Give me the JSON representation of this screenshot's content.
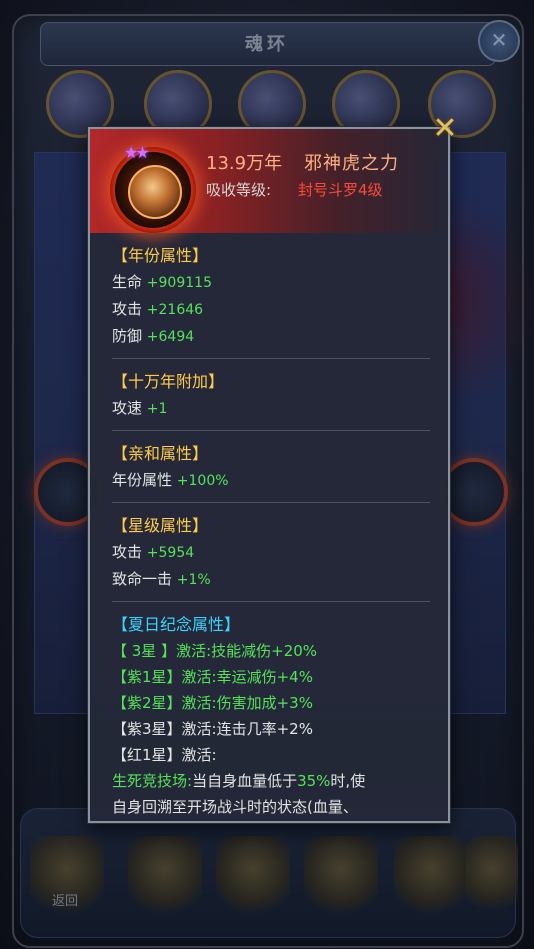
{
  "background": {
    "title": "魂环",
    "bottom_nav": [
      "返回",
      "",
      "",
      "",
      "",
      ""
    ]
  },
  "popup": {
    "years": "13.9万年",
    "name": "邪神虎之力",
    "absorb_label": "吸收等级:",
    "absorb_value": "封号斗罗4级",
    "sections": {
      "year_attr": {
        "title": "【年份属性】",
        "rows": [
          {
            "label": "生命",
            "value": "+909115"
          },
          {
            "label": "攻击",
            "value": "+21646"
          },
          {
            "label": "防御",
            "value": "+6494"
          }
        ]
      },
      "hundred_k": {
        "title": "【十万年附加】",
        "rows": [
          {
            "label": "攻速",
            "value": "+1"
          }
        ]
      },
      "affinity": {
        "title": "【亲和属性】",
        "rows": [
          {
            "label": "年份属性",
            "value": "+100%"
          }
        ]
      },
      "star": {
        "title": "【星级属性】",
        "rows": [
          {
            "label": "攻击",
            "value": "+5954"
          },
          {
            "label": "致命一击",
            "value": "+1%"
          }
        ]
      },
      "summer": {
        "title": "【夏日纪念属性】",
        "lines": [
          {
            "tag": "【 3星 】",
            "text": "激活:技能减伤+20%"
          },
          {
            "tag": "【紫1星】",
            "text": "激活:幸运减伤+4%"
          },
          {
            "tag": "【紫2星】",
            "text": "激活:伤害加成+3%"
          },
          {
            "tag": "【紫3星】",
            "text": "激活:连击几率+2%"
          },
          {
            "tag": "【红1星】",
            "text": "激活:"
          }
        ],
        "arena_label": "生死竞技场:",
        "arena_text_1": "当自身血量低于",
        "arena_pct": "35%",
        "arena_text_2": "时,使",
        "arena_text_3": "自身回溯至开场战斗时的状态(血量、"
      }
    }
  }
}
